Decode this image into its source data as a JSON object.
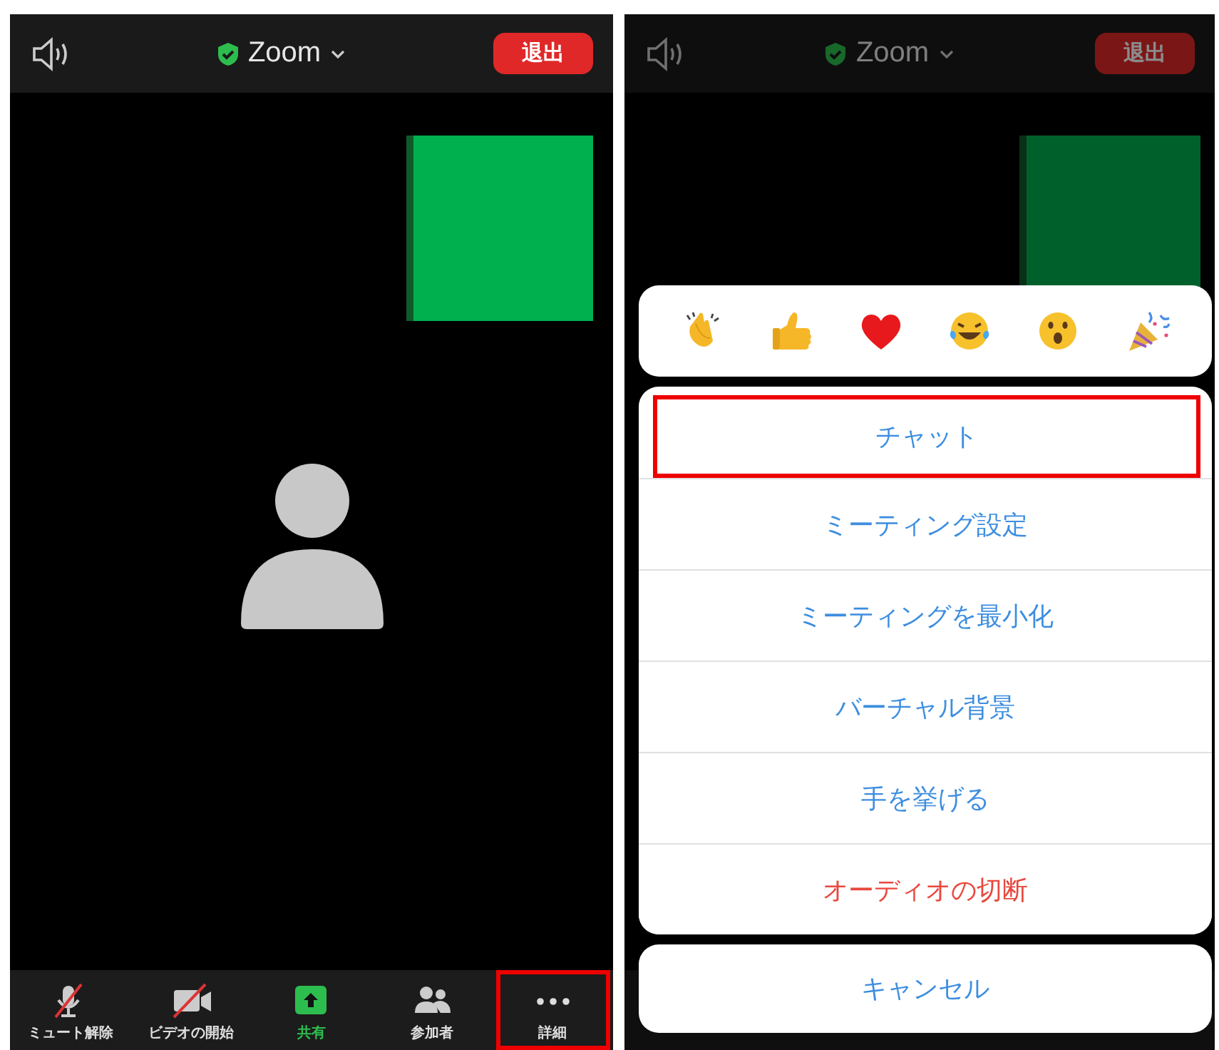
{
  "screens": [
    {
      "dimmed": false,
      "top_bar": {
        "title": "Zoom",
        "leave_button": "退出"
      },
      "toolbar": [
        {
          "kind": "mic",
          "label": "ミュート解除",
          "off": true,
          "highlighted": false
        },
        {
          "kind": "video",
          "label": "ビデオの開始",
          "off": true,
          "highlighted": false
        },
        {
          "kind": "share",
          "label": "共有",
          "highlighted": false
        },
        {
          "kind": "participants",
          "label": "参加者",
          "highlighted": false
        },
        {
          "kind": "more",
          "label": "詳細",
          "highlighted": true
        }
      ]
    },
    {
      "dimmed": true,
      "top_bar": {
        "title": "Zoom",
        "leave_button": "退出"
      },
      "menu": [
        {
          "label": "チャット",
          "kind": "normal",
          "highlighted": true
        },
        {
          "label": "ミーティング設定",
          "kind": "normal",
          "highlighted": false
        },
        {
          "label": "ミーティングを最小化",
          "kind": "normal",
          "highlighted": false
        },
        {
          "label": "バーチャル背景",
          "kind": "normal",
          "highlighted": false
        },
        {
          "label": "手を挙げる",
          "kind": "normal",
          "highlighted": false
        },
        {
          "label": "オーディオの切断",
          "kind": "danger",
          "highlighted": false
        }
      ],
      "cancel_button": "キャンセル"
    }
  ]
}
